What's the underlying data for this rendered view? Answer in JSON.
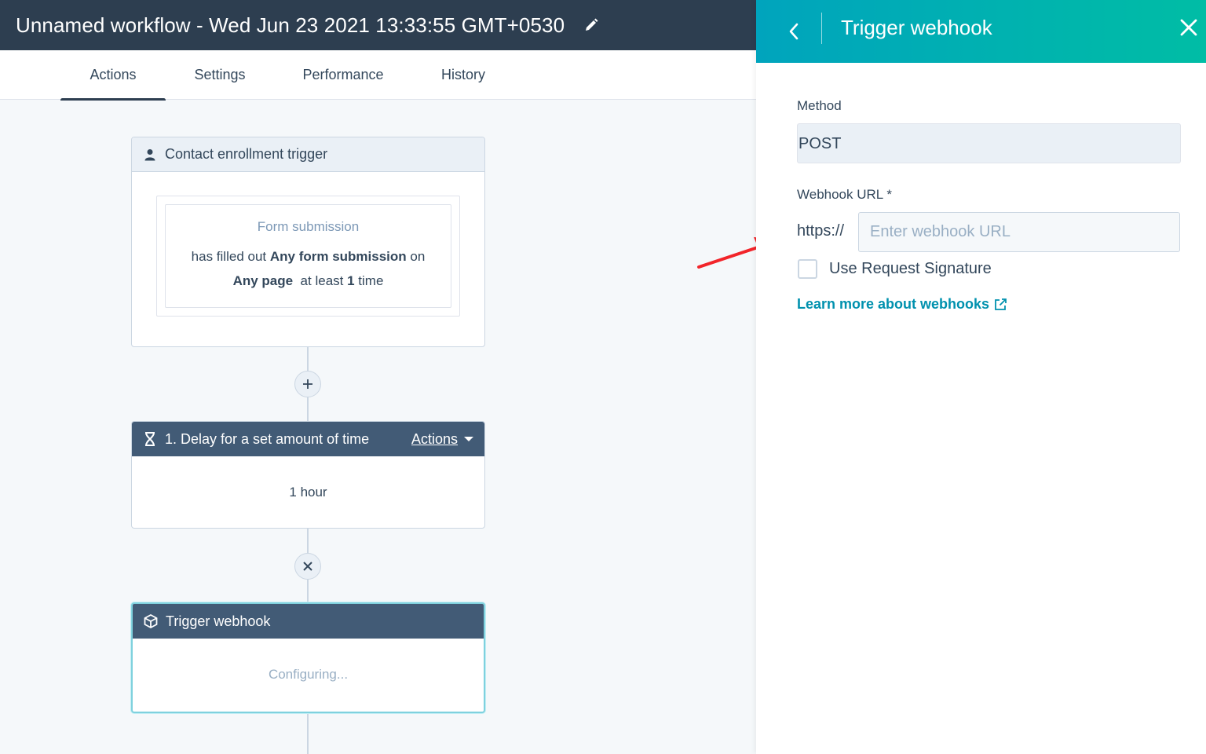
{
  "header": {
    "title": "Unnamed workflow - Wed Jun 23 2021 13:33:55 GMT+0530",
    "edit_icon": "pencil-icon"
  },
  "tabs": [
    {
      "label": "Actions",
      "active": true
    },
    {
      "label": "Settings",
      "active": false
    },
    {
      "label": "Performance",
      "active": false
    },
    {
      "label": "History",
      "active": false
    }
  ],
  "enrollment": {
    "header": "Contact enrollment trigger",
    "icon": "person-icon",
    "filter_title": "Form submission",
    "line1_prefix": "has filled out ",
    "line1_bold": "Any form submission",
    "line1_suffix": " on",
    "line2_bold1": "Any page",
    "line2_mid": "  at least ",
    "line2_bold2": "1",
    "line2_suffix": " time"
  },
  "add_button": "plus-icon",
  "delay": {
    "header": "1. Delay for a set amount of time",
    "icon": "hourglass-icon",
    "actions_label": "Actions",
    "body": "1 hour"
  },
  "remove_button": "close-icon",
  "webhook_card": {
    "header": "Trigger webhook",
    "icon": "cube-icon",
    "body": "Configuring..."
  },
  "panel": {
    "title": "Trigger webhook",
    "method_label": "Method",
    "method_value": "POST",
    "url_label": "Webhook URL *",
    "url_prefix": "https://",
    "url_placeholder": "Enter webhook URL",
    "url_value": "",
    "signature_label": "Use Request Signature",
    "signature_checked": false,
    "learn_link": "Learn more about webhooks"
  },
  "colors": {
    "header_dark": "#2d3e50",
    "card_header_dark": "#425b76",
    "panel_gradient_start": "#00a4bd",
    "panel_gradient_end": "#00bda5",
    "link": "#0091ae",
    "annotation_arrow": "#f2252a"
  }
}
